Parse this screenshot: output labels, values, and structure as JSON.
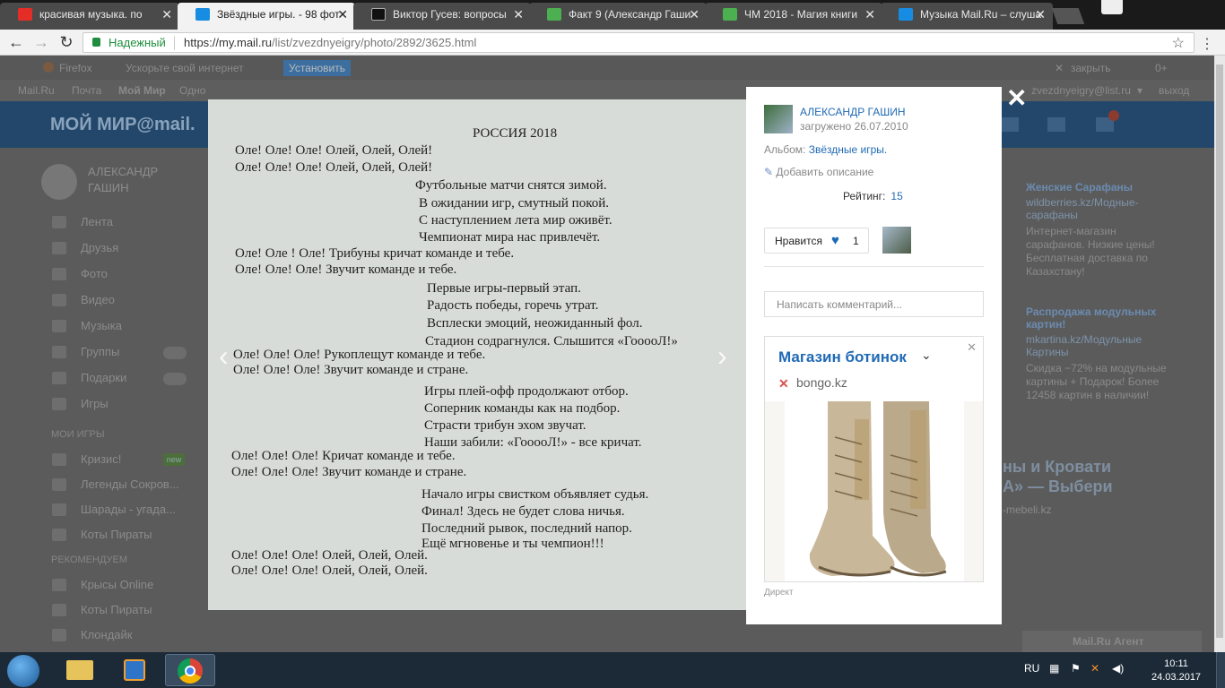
{
  "browser": {
    "tabs": [
      {
        "title": "красивая музыка. по"
      },
      {
        "title": "Звёздные игры. - 98 фот"
      },
      {
        "title": "Виктор Гусев: вопросы"
      },
      {
        "title": "Факт 9 (Александр Гаши"
      },
      {
        "title": "ЧМ 2018 - Магия книги"
      },
      {
        "title": "Музыка Mail.Ru – слуша"
      }
    ],
    "secure_label": "Надежный",
    "url_host": "https://my.mail.ru",
    "url_path": "/list/zvezdnyeigry/photo/2892/3625.html"
  },
  "site": {
    "toolbar": {
      "browser_name": "Firefox",
      "speed_text": "Ускорьте свой интернет",
      "install": "Установить",
      "close": "закрыть",
      "count": "0+"
    },
    "nav": {
      "mail": "Mail.Ru",
      "post": "Почта",
      "myworld": "Мой Мир",
      "classmates": "Одно",
      "user_email": "zvezdnyeigry@list.ru",
      "logout": "выход"
    },
    "logo": "МОЙ МИР@mail.",
    "sidebar": {
      "name_line1": "АЛЕКСАНДР",
      "name_line2": "ГАШИН",
      "items": [
        "Лента",
        "Друзья",
        "Фото",
        "Видео",
        "Музыка",
        "Группы",
        "Подарки",
        "Игры"
      ],
      "games_header": "МОИ ИГРЫ",
      "games": [
        "Кризис!",
        "Легенды Сокров...",
        "Шарады - угада...",
        "Коты Пираты"
      ],
      "new_badge": "new",
      "recommended_header": "РЕКОМЕНДУЕМ",
      "recommended": [
        "Крысы Online",
        "Коты Пираты",
        "Клондайк"
      ]
    },
    "right_ads": [
      {
        "title": "Женские Сарафаны",
        "domain": "wildberries.kz/Модные-сарафаны",
        "text": "Интернет-магазин сарафанов. Низкие цены! Бесплатная доставка по Казахстану!"
      },
      {
        "title": "Распродажа модульных картин!",
        "domain": "mkartina.kz/Модульные Картины",
        "text": "Скидка −72% на модульные картины + Подарок! Более 12458 картин в наличии!"
      }
    ],
    "right_banner": {
      "line1": "ны и Кровати",
      "line2": "А» — Выбери",
      "domain": "-mebeli.kz"
    },
    "agent": "Mail.Ru Агент"
  },
  "photo": {
    "title": "РОССИЯ  2018",
    "lines": [
      "Оле! Оле! Оле! Олей, Олей, Олей!",
      "Оле! Оле! Оле! Олей, Олей, Олей!",
      "Футбольные матчи снятся зимой.",
      "В ожидании игр, смутный покой.",
      "С наступлением лета мир оживёт.",
      "Чемпионат мира нас привлечёт.",
      "Оле! Оле ! Оле! Трибуны кричат команде и тебе.",
      "Оле! Оле! Оле! Звучит команде и тебе.",
      "Первые игры-первый этап.",
      "Радость победы, горечь утрат.",
      "Всплески эмоций, неожиданный фол.",
      "Стадион содрагнулся. Слышится «ГооооЛ!»",
      "Оле! Оле! Оле! Рукоплещут команде и тебе.",
      "Оле! Оле! Оле! Звучит команде и стране.",
      "Игры плей-офф продолжают отбор.",
      "Соперник команды как на подбор.",
      "Страсти трибун эхом звучат.",
      "Наши забили: «ГооооЛ!» - все кричат.",
      "Оле! Оле! Оле! Кричат команде и тебе.",
      "Оле! Оле! Оле! Звучит команде и стране.",
      "Начало игры свистком объявляет судья.",
      "Финал! Здесь не будет слова ничья.",
      "Последний рывок, последний напор.",
      "Ещё мгновенье и ты чемпион!!!",
      "Оле! Оле! Оле! Олей, Олей, Олей.",
      "Оле! Оле! Оле! Олей, Олей, Олей."
    ]
  },
  "panel": {
    "author": "АЛЕКСАНДР ГАШИН",
    "uploaded": "загружено 26.07.2010",
    "album_label": "Альбом:",
    "album_name": "Звёздные игры.",
    "add_description": "Добавить описание",
    "rating_label": "Рейтинг:",
    "rating_value": "15",
    "like_label": "Нравится",
    "like_count": "1",
    "comment_placeholder": "Написать комментарий...",
    "ad": {
      "title": "Магазин ботинок",
      "domain": "bongo.kz",
      "footer": "Директ"
    }
  },
  "taskbar": {
    "lang": "RU",
    "time": "10:11",
    "date": "24.03.2017"
  }
}
